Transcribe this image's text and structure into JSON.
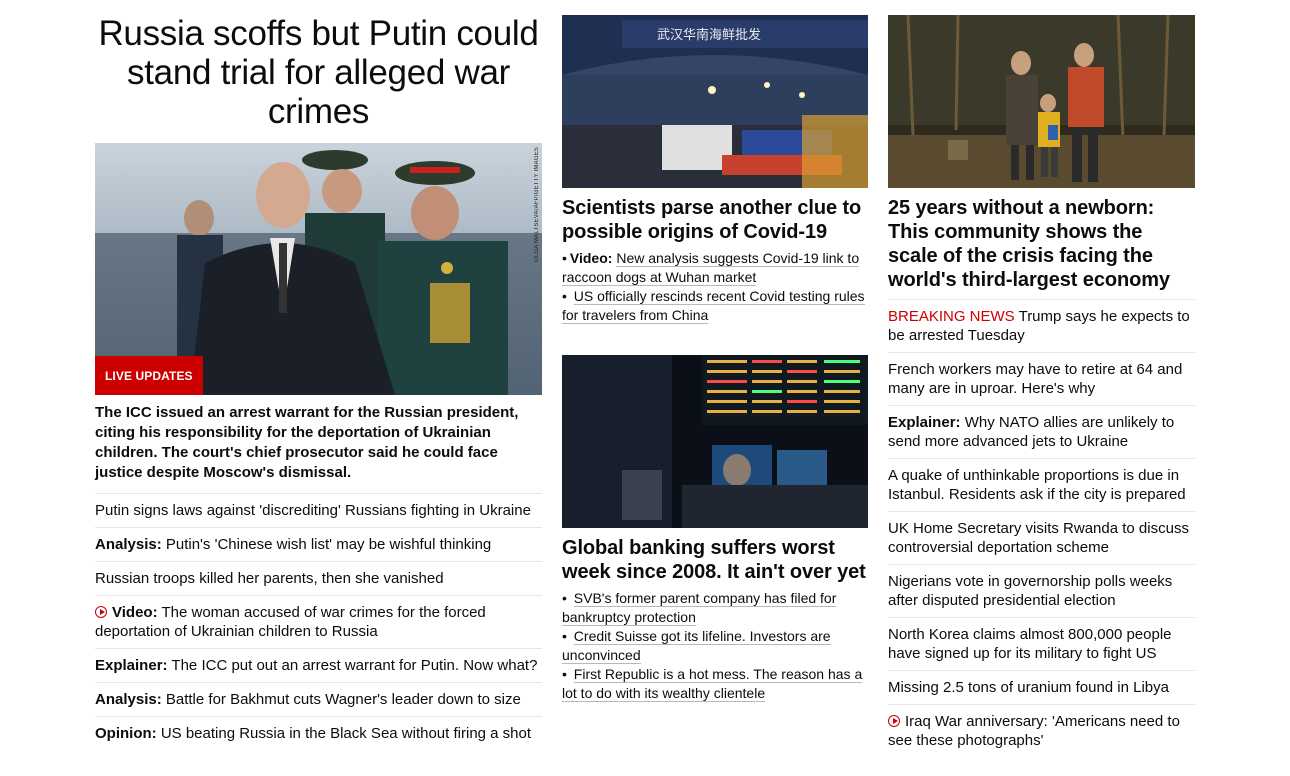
{
  "lead": {
    "headline": "Russia scoffs but Putin could stand trial for alleged war crimes",
    "image_credit": "OLGA MALTSEVA/AFP/GETTY IMAGES",
    "badge": "LIVE UPDATES",
    "summary": "The ICC issued an arrest warrant for the Russian president, citing his responsibility for the deportation of Ukrainian children. The court's chief prosecutor said he could face justice despite Moscow's dismissal.",
    "related": [
      {
        "prefix": "",
        "text": "Putin signs laws against 'discrediting' Russians fighting in Ukraine"
      },
      {
        "prefix": "Analysis:",
        "text": " Putin's 'Chinese wish list' may be wishful thinking"
      },
      {
        "prefix": "",
        "text": "Russian troops killed her parents, then she vanished"
      },
      {
        "prefix": "Video:",
        "text": " The woman accused of war crimes for the forced deportation of Ukrainian children to Russia"
      },
      {
        "prefix": "Explainer:",
        "text": " The ICC put out an arrest warrant for Putin. Now what?"
      },
      {
        "prefix": "Analysis:",
        "text": " Battle for Bakhmut cuts Wagner's leader down to size"
      },
      {
        "prefix": "Opinion:",
        "text": " US beating Russia in the Black Sea without firing a shot"
      }
    ]
  },
  "middle": {
    "story1": {
      "headline": "Scientists parse another clue to possible origins of Covid-19",
      "image_sign": "武汉华南海鲜批发",
      "links": [
        {
          "prefix": "Video:",
          "text": "New analysis suggests Covid-19 link to raccoon dogs at Wuhan market"
        },
        {
          "prefix": "",
          "text": "US officially rescinds recent Covid testing rules for travelers from China"
        }
      ]
    },
    "story2": {
      "headline": "Global banking suffers worst week since 2008. It ain't over yet",
      "links": [
        {
          "text": "SVB's former parent company has filed for bankruptcy protection"
        },
        {
          "text": "Credit Suisse got its lifeline. Investors are unconvinced"
        },
        {
          "text": "First Republic is a hot mess. The reason has a lot to do with its wealthy clientele"
        }
      ]
    }
  },
  "right": {
    "headline": "25 years without a newborn: This community shows the scale of the crisis facing the world's third-largest economy",
    "items": [
      {
        "prefix": "BREAKING NEWS",
        "text": " Trump says he expects to be arrested Tuesday"
      },
      {
        "prefix": "",
        "text": "French workers may have to retire at 64 and many are in uproar. Here's why"
      },
      {
        "prefix": "Explainer:",
        "text": " Why NATO allies are unlikely to send more advanced jets to Ukraine"
      },
      {
        "prefix": "",
        "text": "A quake of unthinkable proportions is due in Istanbul. Residents ask if the city is prepared"
      },
      {
        "prefix": "",
        "text": "UK Home Secretary visits Rwanda to discuss controversial deportation scheme"
      },
      {
        "prefix": "",
        "text": "Nigerians vote in governorship polls weeks after disputed presidential election"
      },
      {
        "prefix": "",
        "text": "North Korea claims almost 800,000 people have signed up for its military to fight US"
      },
      {
        "prefix": "",
        "text": "Missing 2.5 tons of uranium found in Libya"
      },
      {
        "prefix": "",
        "text": "Iraq War anniversary: 'Americans need to see these photographs'"
      }
    ]
  },
  "colors": {
    "accent": "#cc0000",
    "divider": "#e6e6e6"
  }
}
